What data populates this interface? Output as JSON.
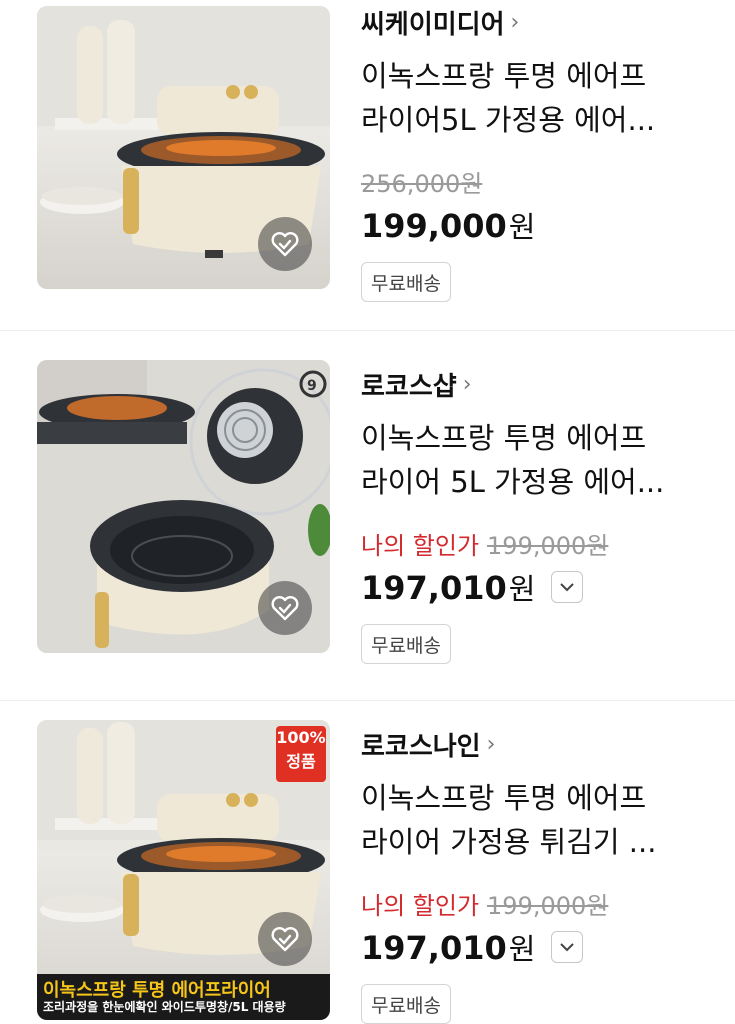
{
  "products": [
    {
      "seller": "씨케이미디어",
      "title_lines": [
        "이녹스프랑 투명 에어프",
        "라이어5L 가정용 에어..."
      ],
      "original_price": "256,000원",
      "price": "199,000",
      "currency": "원",
      "shipping_badge": "무료배송"
    },
    {
      "seller": "로코스샵",
      "title_lines": [
        "이녹스프랑 투명 에어프",
        "라이어 5L 가정용 에어..."
      ],
      "my_discount_label": "나의 할인가",
      "original_price": "199,000원",
      "price": "197,010",
      "currency": "원",
      "shipping_badge": "무료배송",
      "thumb_corner_mark": "9"
    },
    {
      "seller": "로코스나인",
      "title_lines": [
        "이녹스프랑 투명 에어프",
        "라이어 가정용 튀김기 ..."
      ],
      "my_discount_label": "나의 할인가",
      "original_price": "199,000원",
      "price": "197,010",
      "currency": "원",
      "shipping_badge": "무료배송",
      "thumb_badge": [
        "100%",
        "정품"
      ],
      "thumb_banner": [
        "이녹스프랑 투명 에어프라이어",
        "조리과정을 한눈에확인 와이드투명창/5L 대용량"
      ]
    }
  ],
  "colors": {
    "discount_red": "#d32a2e",
    "cream": "#efe8d6",
    "dark_rim": "#2f3338",
    "gold": "#d8b25a"
  },
  "icons": {
    "wishlist": "heart-check-icon",
    "chevron": "chevron-right-icon",
    "dropdown": "chevron-down-icon"
  }
}
